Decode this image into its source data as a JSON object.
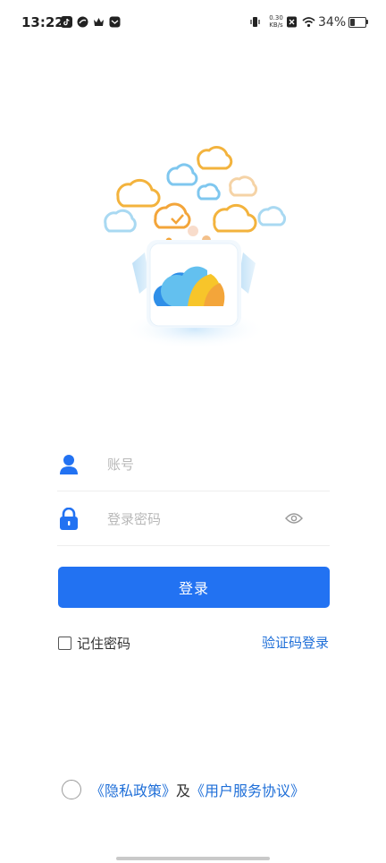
{
  "status_bar": {
    "time": "13:22",
    "net_speed_value": "0.30",
    "net_speed_unit": "KB/s",
    "battery_percent": "34%",
    "battery_level": 0.34,
    "icons": [
      "tiktok-icon",
      "app-icon",
      "crown-icon",
      "notification-icon",
      "vibrate-icon",
      "sim-off-icon",
      "wifi-icon",
      "battery-icon"
    ]
  },
  "login": {
    "account_placeholder": "账号",
    "password_placeholder": "登录密码",
    "submit_label": "登录",
    "remember_label": "记住密码",
    "code_login_label": "验证码登录"
  },
  "agreement": {
    "privacy_link": "《隐私政策》",
    "and_text": "及",
    "service_link": "《用户服务协议》"
  },
  "colors": {
    "primary": "#2272f2",
    "link": "#1f6fd8",
    "accent_orange": "#f3a53a",
    "accent_lightblue": "#7fc7ef"
  }
}
